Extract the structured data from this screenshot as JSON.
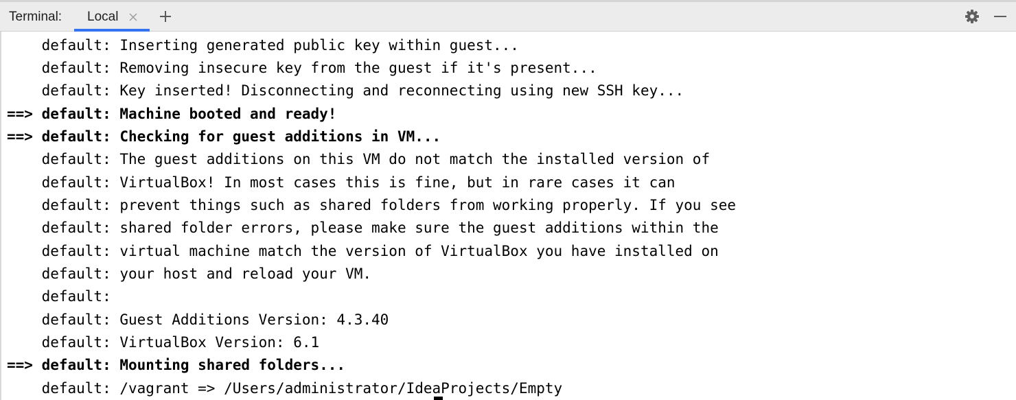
{
  "header": {
    "title": "Terminal:",
    "tabs": [
      {
        "label": "Local",
        "active": true
      }
    ],
    "icons": {
      "tab_close": "close-icon",
      "add_tab": "plus-icon",
      "settings": "gear-icon",
      "hide": "minimize-icon"
    }
  },
  "colors": {
    "accent": "#3574f0",
    "header_bg": "#ececec",
    "console_bg": "#ffffff",
    "text": "#000000"
  },
  "console": {
    "lines": [
      "    default: Inserting generated public key within guest...",
      "    default: Removing insecure key from the guest if it's present...",
      "    default: Key inserted! Disconnecting and reconnecting using new SSH key...",
      "==> default: Machine booted and ready!",
      "==> default: Checking for guest additions in VM...",
      "    default: The guest additions on this VM do not match the installed version of",
      "    default: VirtualBox! In most cases this is fine, but in rare cases it can",
      "    default: prevent things such as shared folders from working properly. If you see",
      "    default: shared folder errors, please make sure the guest additions within the",
      "    default: virtual machine match the version of VirtualBox you have installed on",
      "    default: your host and reload your VM.",
      "    default:",
      "    default: Guest Additions Version: 4.3.40",
      "    default: VirtualBox Version: 6.1",
      "==> default: Mounting shared folders...",
      "    default: /vagrant => /Users/administrator/IdeaProjects/Empty"
    ]
  }
}
